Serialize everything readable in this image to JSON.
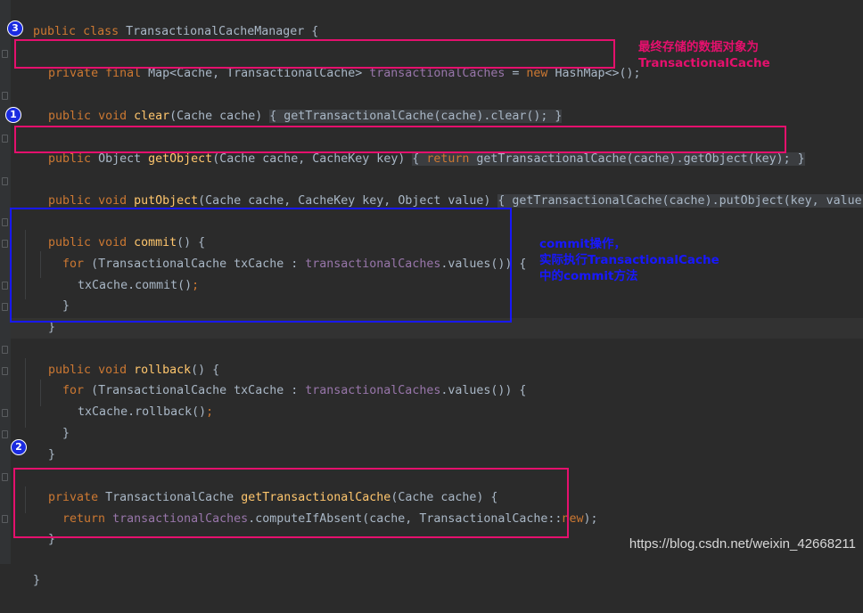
{
  "code": {
    "class_decl": {
      "kw": "public class ",
      "name": "TransactionalCacheManager",
      "brace": " {"
    },
    "field_line": {
      "kw1": "private final ",
      "t1": "Map<Cache, TransactionalCache> ",
      "field": "transactionalCaches",
      "t2": " = ",
      "kw2": "new",
      "t3": " HashMap<>();"
    },
    "clear_line": {
      "kw": "public void ",
      "fn": "clear",
      "params": "(Cache cache) ",
      "body": "{ getTransactionalCache(cache).clear(); }"
    },
    "get_line": {
      "kw": "public ",
      "t1": "Object ",
      "fn": "getObject",
      "params": "(Cache cache, CacheKey key) ",
      "b1": "{ ",
      "kw2": "return",
      "b2": " getTransactionalCache(cache).getObject(key); }"
    },
    "put_line": {
      "kw": "public void ",
      "fn": "putObject",
      "params": "(Cache cache, CacheKey key, Object value) ",
      "body": "{ getTransactionalCache(cache).putObject(key, value); }"
    },
    "commit_sig": {
      "kw": "public void ",
      "fn": "commit",
      "rest": "() {"
    },
    "commit_for": {
      "kw": "for",
      "t1": " (TransactionalCache txCache : ",
      "field": "transactionalCaches",
      "t2": ".values()) {"
    },
    "commit_call": {
      "t1": "txCache.commit()",
      "semi": ";"
    },
    "close_inner": "}",
    "close_method": "}",
    "rollback_sig": {
      "kw": "public void ",
      "fn": "rollback",
      "rest": "() {"
    },
    "rollback_for": {
      "kw": "for",
      "t1": " (TransactionalCache txCache : ",
      "field": "transactionalCaches",
      "t2": ".values()) {"
    },
    "rollback_call": {
      "t1": "txCache.rollback()",
      "semi": ";"
    },
    "get_tc_sig": {
      "kw": "private ",
      "t1": "TransactionalCache ",
      "fn": "getTransactionalCache",
      "rest": "(Cache cache) {"
    },
    "get_tc_return": {
      "kw": "return ",
      "field": "transactionalCaches",
      "t1": ".computeIfAbsent(cache, TransactionalCache::",
      "kw2": "new",
      "t2": ");"
    },
    "close_class": "}"
  },
  "annotations": {
    "badge_3": "3",
    "badge_1": "1",
    "badge_2": "2",
    "note_storage_line1": "最终存储的数据对象为",
    "note_storage_line2": "TransactionalCache",
    "note_commit_line1": "commit操作，",
    "note_commit_line2": "实际执行TransactionalCache",
    "note_commit_line3": "中的commit方法"
  },
  "watermark": "https://blog.csdn.net/weixin_42668211",
  "colors": {
    "background": "#2b2b2b",
    "keyword": "#cc7832",
    "method": "#ffc66d",
    "field": "#9876aa",
    "text": "#a9b7c6",
    "highlight_pink": "#e5106d",
    "highlight_blue": "#1818ff"
  }
}
